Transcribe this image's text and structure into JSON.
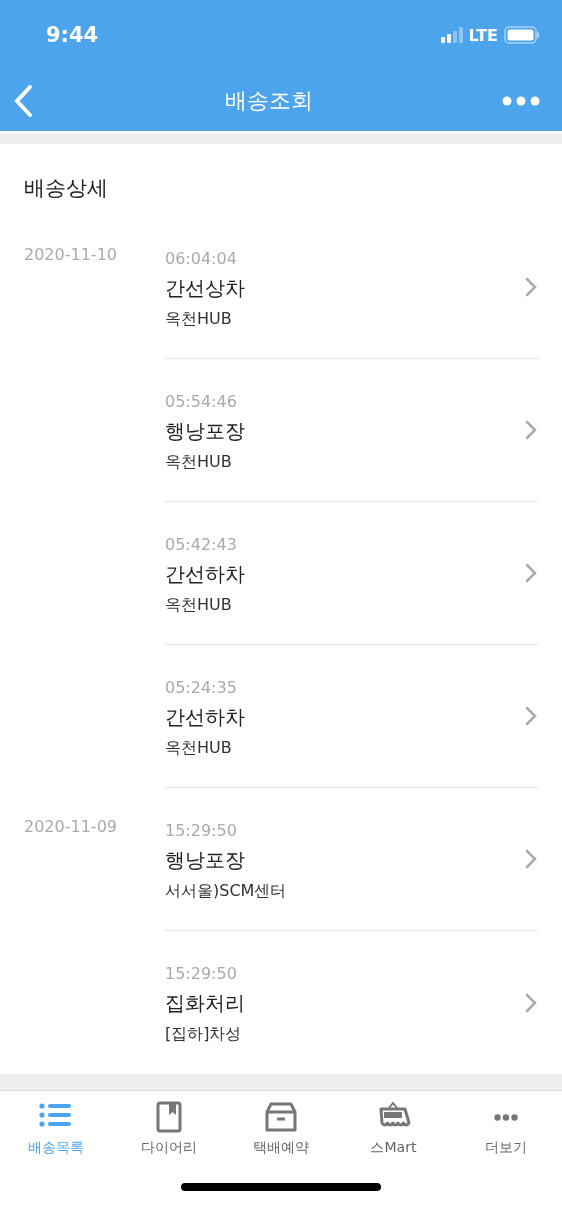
{
  "status_bar": {
    "time": "9:44",
    "network": "LTE"
  },
  "nav": {
    "title": "배송조회"
  },
  "section": {
    "title": "배송상세"
  },
  "groups": [
    {
      "date": "2020-11-10",
      "events": [
        {
          "time": "06:04:04",
          "status": "간선상차",
          "location": "옥천HUB"
        },
        {
          "time": "05:54:46",
          "status": "행낭포장",
          "location": "옥천HUB"
        },
        {
          "time": "05:42:43",
          "status": "간선하차",
          "location": "옥천HUB"
        },
        {
          "time": "05:24:35",
          "status": "간선하차",
          "location": "옥천HUB"
        }
      ]
    },
    {
      "date": "2020-11-09",
      "events": [
        {
          "time": "15:29:50",
          "status": "행낭포장",
          "location": "서서울)SCM센터"
        },
        {
          "time": "15:29:50",
          "status": "집화처리",
          "location": "[집하]차성"
        }
      ]
    }
  ],
  "tab_bar": [
    {
      "label": "배송목록",
      "kind": "list",
      "selected": true
    },
    {
      "label": "다이어리",
      "kind": "book",
      "selected": false
    },
    {
      "label": "택배예약",
      "kind": "box",
      "selected": false
    },
    {
      "label": "스Mart",
      "kind": "shop",
      "selected": false
    },
    {
      "label": "더보기",
      "kind": "more",
      "selected": false
    }
  ]
}
